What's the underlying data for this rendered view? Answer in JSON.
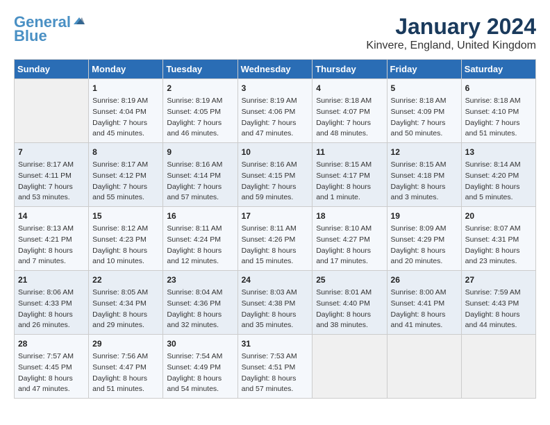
{
  "logo": {
    "line1": "General",
    "line2": "Blue"
  },
  "title": "January 2024",
  "subtitle": "Kinvere, England, United Kingdom",
  "days_of_week": [
    "Sunday",
    "Monday",
    "Tuesday",
    "Wednesday",
    "Thursday",
    "Friday",
    "Saturday"
  ],
  "weeks": [
    [
      {
        "num": "",
        "detail": ""
      },
      {
        "num": "1",
        "detail": "Sunrise: 8:19 AM\nSunset: 4:04 PM\nDaylight: 7 hours\nand 45 minutes."
      },
      {
        "num": "2",
        "detail": "Sunrise: 8:19 AM\nSunset: 4:05 PM\nDaylight: 7 hours\nand 46 minutes."
      },
      {
        "num": "3",
        "detail": "Sunrise: 8:19 AM\nSunset: 4:06 PM\nDaylight: 7 hours\nand 47 minutes."
      },
      {
        "num": "4",
        "detail": "Sunrise: 8:18 AM\nSunset: 4:07 PM\nDaylight: 7 hours\nand 48 minutes."
      },
      {
        "num": "5",
        "detail": "Sunrise: 8:18 AM\nSunset: 4:09 PM\nDaylight: 7 hours\nand 50 minutes."
      },
      {
        "num": "6",
        "detail": "Sunrise: 8:18 AM\nSunset: 4:10 PM\nDaylight: 7 hours\nand 51 minutes."
      }
    ],
    [
      {
        "num": "7",
        "detail": "Sunrise: 8:17 AM\nSunset: 4:11 PM\nDaylight: 7 hours\nand 53 minutes."
      },
      {
        "num": "8",
        "detail": "Sunrise: 8:17 AM\nSunset: 4:12 PM\nDaylight: 7 hours\nand 55 minutes."
      },
      {
        "num": "9",
        "detail": "Sunrise: 8:16 AM\nSunset: 4:14 PM\nDaylight: 7 hours\nand 57 minutes."
      },
      {
        "num": "10",
        "detail": "Sunrise: 8:16 AM\nSunset: 4:15 PM\nDaylight: 7 hours\nand 59 minutes."
      },
      {
        "num": "11",
        "detail": "Sunrise: 8:15 AM\nSunset: 4:17 PM\nDaylight: 8 hours\nand 1 minute."
      },
      {
        "num": "12",
        "detail": "Sunrise: 8:15 AM\nSunset: 4:18 PM\nDaylight: 8 hours\nand 3 minutes."
      },
      {
        "num": "13",
        "detail": "Sunrise: 8:14 AM\nSunset: 4:20 PM\nDaylight: 8 hours\nand 5 minutes."
      }
    ],
    [
      {
        "num": "14",
        "detail": "Sunrise: 8:13 AM\nSunset: 4:21 PM\nDaylight: 8 hours\nand 7 minutes."
      },
      {
        "num": "15",
        "detail": "Sunrise: 8:12 AM\nSunset: 4:23 PM\nDaylight: 8 hours\nand 10 minutes."
      },
      {
        "num": "16",
        "detail": "Sunrise: 8:11 AM\nSunset: 4:24 PM\nDaylight: 8 hours\nand 12 minutes."
      },
      {
        "num": "17",
        "detail": "Sunrise: 8:11 AM\nSunset: 4:26 PM\nDaylight: 8 hours\nand 15 minutes."
      },
      {
        "num": "18",
        "detail": "Sunrise: 8:10 AM\nSunset: 4:27 PM\nDaylight: 8 hours\nand 17 minutes."
      },
      {
        "num": "19",
        "detail": "Sunrise: 8:09 AM\nSunset: 4:29 PM\nDaylight: 8 hours\nand 20 minutes."
      },
      {
        "num": "20",
        "detail": "Sunrise: 8:07 AM\nSunset: 4:31 PM\nDaylight: 8 hours\nand 23 minutes."
      }
    ],
    [
      {
        "num": "21",
        "detail": "Sunrise: 8:06 AM\nSunset: 4:33 PM\nDaylight: 8 hours\nand 26 minutes."
      },
      {
        "num": "22",
        "detail": "Sunrise: 8:05 AM\nSunset: 4:34 PM\nDaylight: 8 hours\nand 29 minutes."
      },
      {
        "num": "23",
        "detail": "Sunrise: 8:04 AM\nSunset: 4:36 PM\nDaylight: 8 hours\nand 32 minutes."
      },
      {
        "num": "24",
        "detail": "Sunrise: 8:03 AM\nSunset: 4:38 PM\nDaylight: 8 hours\nand 35 minutes."
      },
      {
        "num": "25",
        "detail": "Sunrise: 8:01 AM\nSunset: 4:40 PM\nDaylight: 8 hours\nand 38 minutes."
      },
      {
        "num": "26",
        "detail": "Sunrise: 8:00 AM\nSunset: 4:41 PM\nDaylight: 8 hours\nand 41 minutes."
      },
      {
        "num": "27",
        "detail": "Sunrise: 7:59 AM\nSunset: 4:43 PM\nDaylight: 8 hours\nand 44 minutes."
      }
    ],
    [
      {
        "num": "28",
        "detail": "Sunrise: 7:57 AM\nSunset: 4:45 PM\nDaylight: 8 hours\nand 47 minutes."
      },
      {
        "num": "29",
        "detail": "Sunrise: 7:56 AM\nSunset: 4:47 PM\nDaylight: 8 hours\nand 51 minutes."
      },
      {
        "num": "30",
        "detail": "Sunrise: 7:54 AM\nSunset: 4:49 PM\nDaylight: 8 hours\nand 54 minutes."
      },
      {
        "num": "31",
        "detail": "Sunrise: 7:53 AM\nSunset: 4:51 PM\nDaylight: 8 hours\nand 57 minutes."
      },
      {
        "num": "",
        "detail": ""
      },
      {
        "num": "",
        "detail": ""
      },
      {
        "num": "",
        "detail": ""
      }
    ]
  ]
}
